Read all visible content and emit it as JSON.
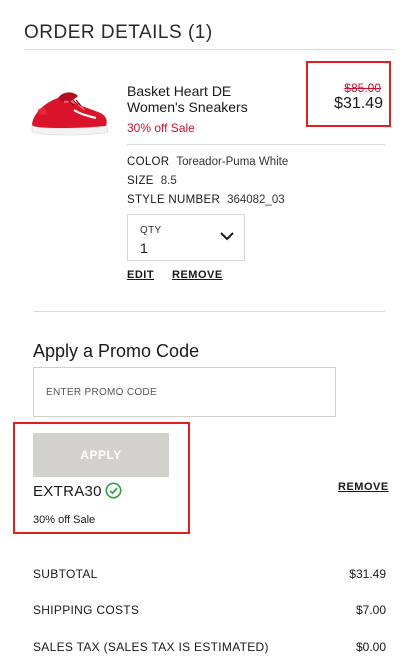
{
  "order": {
    "title": "ORDER DETAILS (1)"
  },
  "product": {
    "name": "Basket Heart DE Women's Sneakers",
    "sale_note": "30% off Sale",
    "original_price": "$85.00",
    "sale_price": "$31.49",
    "image_icon": "red-sneaker-image",
    "attributes": [
      {
        "key": "COLOR",
        "value": "Toreador-Puma White"
      },
      {
        "key": "SIZE",
        "value": "8.5"
      },
      {
        "key": "STYLE NUMBER",
        "value": "364082_03"
      }
    ],
    "qty_label": "QTY",
    "qty_value": "1",
    "edit_label": "EDIT",
    "remove_label": "REMOVE"
  },
  "promo": {
    "title": "Apply a Promo Code",
    "placeholder": "ENTER PROMO CODE",
    "value": "",
    "apply_label": "APPLY",
    "applied_code": "EXTRA30",
    "applied_desc": "30% off Sale",
    "remove_label": "REMOVE"
  },
  "summary": {
    "subtotal_label": "SUBTOTAL",
    "subtotal_value": "$31.49",
    "shipping_label": "SHIPPING COSTS",
    "shipping_value": "$7.00",
    "tax_label": "SALES TAX (SALES TAX IS ESTIMATED)",
    "tax_value": "$0.00"
  },
  "colors": {
    "sale_red": "#c8102e",
    "highlight_red": "#e02020",
    "apply_disabled": "#d3d1cb",
    "check_green": "#2e9e44"
  }
}
